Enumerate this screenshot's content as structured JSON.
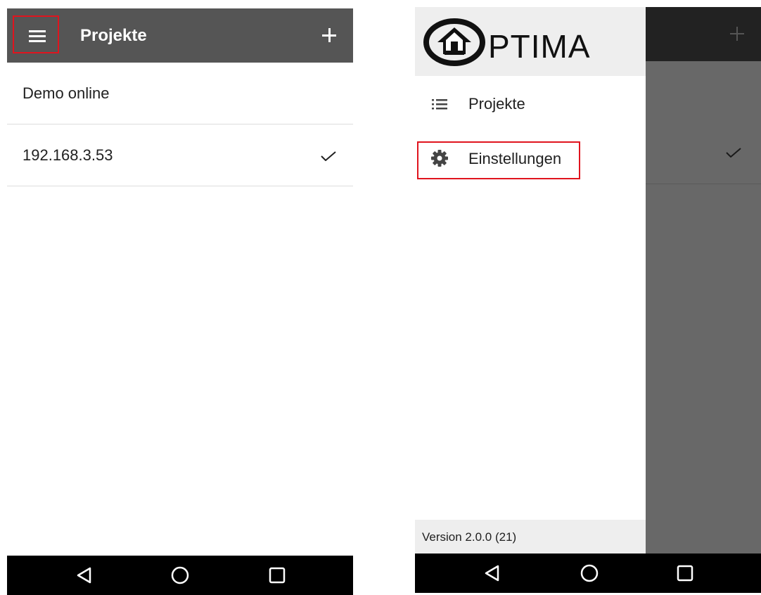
{
  "left_screen": {
    "toolbar": {
      "title": "Projekte",
      "menu_icon": "hamburger-icon",
      "add_icon": "plus-icon"
    },
    "projects": [
      {
        "name": "Demo online",
        "selected": false
      },
      {
        "name": "192.168.3.53",
        "selected": true
      }
    ]
  },
  "right_screen": {
    "drawer": {
      "logo_text": "PTIMA",
      "items": [
        {
          "label": "Projekte",
          "icon": "list-icon"
        },
        {
          "label": "Einstellungen",
          "icon": "gear-icon"
        }
      ],
      "version": "Version 2.0.0 (21)"
    }
  },
  "navbar": {
    "back_icon": "back-triangle-icon",
    "home_icon": "home-circle-icon",
    "recents_icon": "recents-square-icon"
  },
  "colors": {
    "toolbar": "#555555",
    "highlight": "#e0141e",
    "navbar": "#000000",
    "scrim": "#686868"
  }
}
